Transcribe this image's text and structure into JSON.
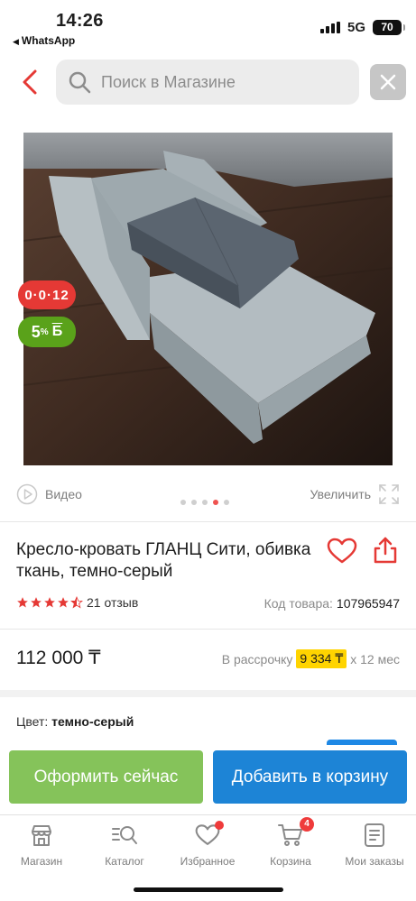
{
  "status_bar": {
    "time": "14:26",
    "back_app": "WhatsApp",
    "network": "5G",
    "battery": "70"
  },
  "search": {
    "placeholder": "Поиск в Магазине"
  },
  "product": {
    "badges": {
      "installment": "0·0·12",
      "bonus_percent": "5",
      "bonus_suffix": "%",
      "bonus_currency": "Б"
    },
    "video_label": "Видео",
    "zoom_label": "Увеличить",
    "gallery": {
      "count": 5,
      "active_index": 3
    },
    "title": "Кресло-кровать ГЛАНЦ Сити, обивка ткань, темно-серый",
    "rating": {
      "stars": 4.5,
      "reviews": "21 отзыв"
    },
    "code_label": "Код товара:",
    "code_value": "107965947",
    "price": "112 000 ₸",
    "installment_prefix": "В рассрочку",
    "installment_amount": "9 334 ₸",
    "installment_suffix": "х 12 мес",
    "color_label": "Цвет:",
    "color_value": "темно-серый"
  },
  "actions": {
    "checkout_label": "Оформить сейчас",
    "add_to_cart_label": "Добавить в корзину"
  },
  "tab_bar": {
    "items": [
      {
        "label": "Магазин",
        "icon": "store-icon"
      },
      {
        "label": "Каталог",
        "icon": "catalog-search-icon"
      },
      {
        "label": "Избранное",
        "icon": "heart-icon"
      },
      {
        "label": "Корзина",
        "icon": "cart-icon",
        "badge": "4"
      },
      {
        "label": "Мои заказы",
        "icon": "orders-icon"
      }
    ]
  },
  "colors": {
    "accent_red": "#e53935",
    "checkout_green": "#85c35a",
    "cart_blue": "#1d84d6",
    "installment_yellow": "#ffd400",
    "bonus_green": "#5aa21a"
  }
}
